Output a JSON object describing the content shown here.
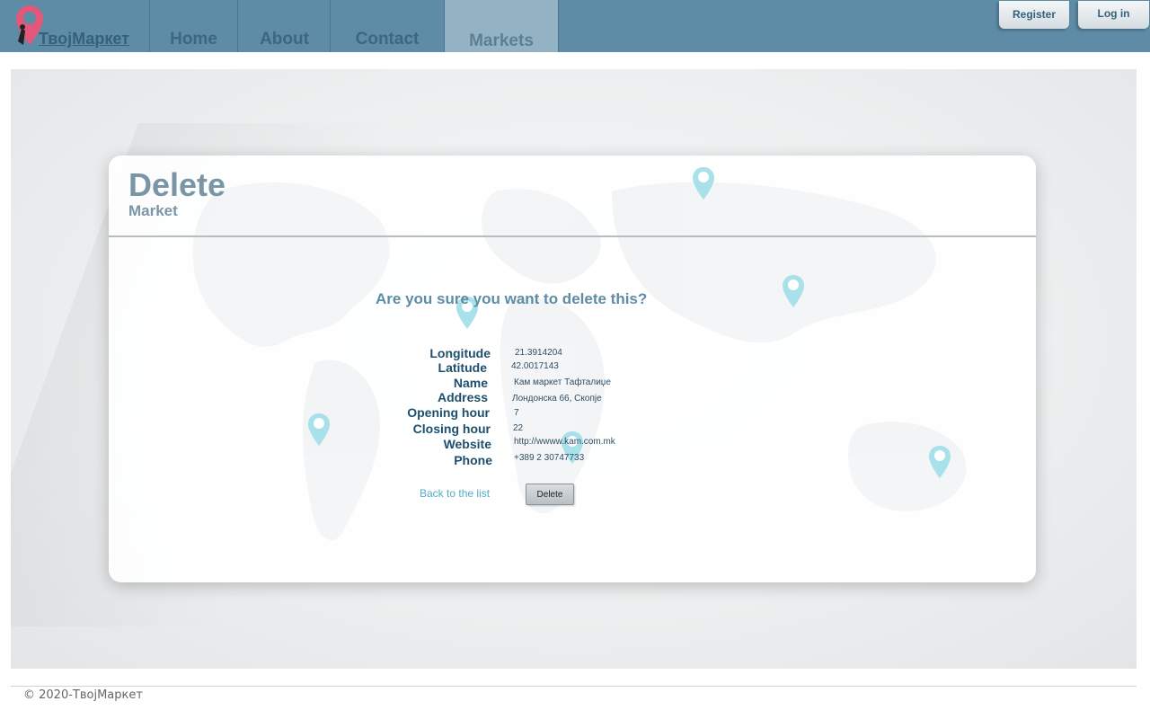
{
  "nav": {
    "brand": "ТвојМаркет",
    "home": "Home",
    "about": "About",
    "contact": "Contact",
    "markets": "Markets",
    "register": "Register",
    "login": "Log in"
  },
  "card": {
    "title": "Delete",
    "subtitle": "Market",
    "question": "Are you sure you want to delete this?"
  },
  "details": {
    "longitude": {
      "label": "Longitude",
      "value": "21.3914204"
    },
    "latitude": {
      "label": "Latitude",
      "value": "42.0017143"
    },
    "name": {
      "label": "Name",
      "value": "Кам маркет Тафталиџе"
    },
    "address": {
      "label": "Address",
      "value": "Лондонска 66, Скопје"
    },
    "opening": {
      "label": "Opening hour",
      "value": "7"
    },
    "closing": {
      "label": "Closing hour",
      "value": "22"
    },
    "website": {
      "label": "Website",
      "value": "http://wwww.kam.com.mk"
    },
    "phone": {
      "label": "Phone",
      "value": "+389 2 30747733"
    }
  },
  "actions": {
    "back": "Back to the list",
    "delete": "Delete"
  },
  "footer": {
    "copyright": "© 2020-ТвојМаркет"
  },
  "colors": {
    "navbar": "#5e8ca6",
    "pin": "#a9e1ea",
    "label": "#1f4e6d",
    "link": "#4fb0c6"
  },
  "icons": {
    "brand": "location-pin-icon",
    "map_pins": "map-pin-icon"
  }
}
